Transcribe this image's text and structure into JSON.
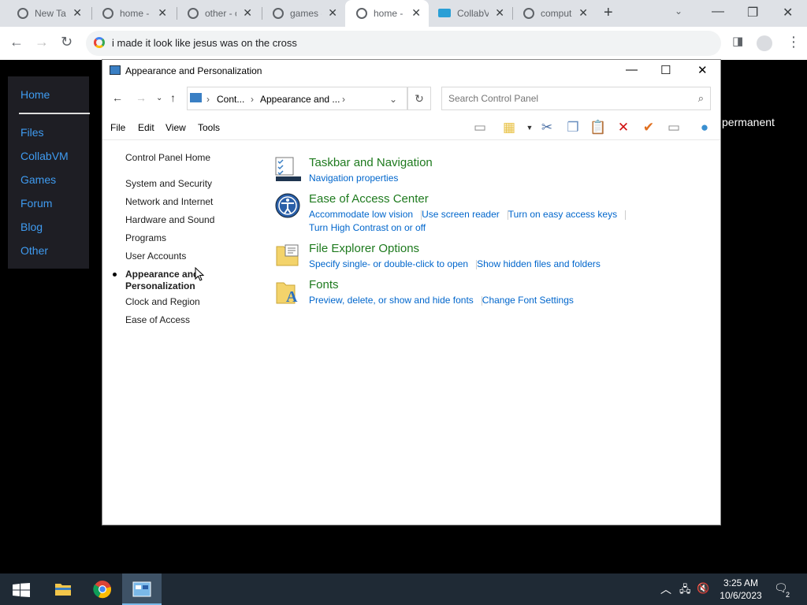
{
  "browser": {
    "tabs": [
      {
        "title": "New Tab",
        "active": false
      },
      {
        "title": "home - collabvm",
        "active": false
      },
      {
        "title": "other - collabvm",
        "active": false
      },
      {
        "title": "games - collabvm",
        "active": false
      },
      {
        "title": "home - collabvm",
        "active": true
      },
      {
        "title": "CollabVM",
        "active": false
      },
      {
        "title": "computer",
        "active": false
      }
    ],
    "omnibox_text": "i made it look like jesus was on the cross"
  },
  "website": {
    "nav": [
      "Home",
      "Files",
      "CollabVM",
      "Games",
      "Forum",
      "Blog",
      "Other"
    ],
    "partial_text": "permanent"
  },
  "control_panel": {
    "window_title": "Appearance and Personalization",
    "breadcrumb": [
      "Cont...",
      "Appearance and ..."
    ],
    "search_placeholder": "Search Control Panel",
    "menu": [
      "File",
      "Edit",
      "View",
      "Tools"
    ],
    "left_pane": {
      "home": "Control Panel Home",
      "items": [
        "System and Security",
        "Network and Internet",
        "Hardware and Sound",
        "Programs",
        "User Accounts",
        "Appearance and Personalization",
        "Clock and Region",
        "Ease of Access"
      ],
      "selected_index": 5
    },
    "categories": [
      {
        "title": "Taskbar and Navigation",
        "links": [
          "Navigation properties"
        ]
      },
      {
        "title": "Ease of Access Center",
        "links": [
          "Accommodate low vision",
          "Use screen reader",
          "Turn on easy access keys",
          "Turn High Contrast on or off"
        ]
      },
      {
        "title": "File Explorer Options",
        "links": [
          "Specify single- or double-click to open",
          "Show hidden files and folders"
        ]
      },
      {
        "title": "Fonts",
        "links": [
          "Preview, delete, or show and hide fonts",
          "Change Font Settings"
        ]
      }
    ]
  },
  "taskbar": {
    "time": "3:25 AM",
    "date": "10/6/2023",
    "notification_count": "2"
  },
  "colors": {
    "link": "#0066cc",
    "category_title": "#1e7a1e",
    "site_nav_link": "#3f9bf0",
    "taskbar": "#1f2a35"
  }
}
